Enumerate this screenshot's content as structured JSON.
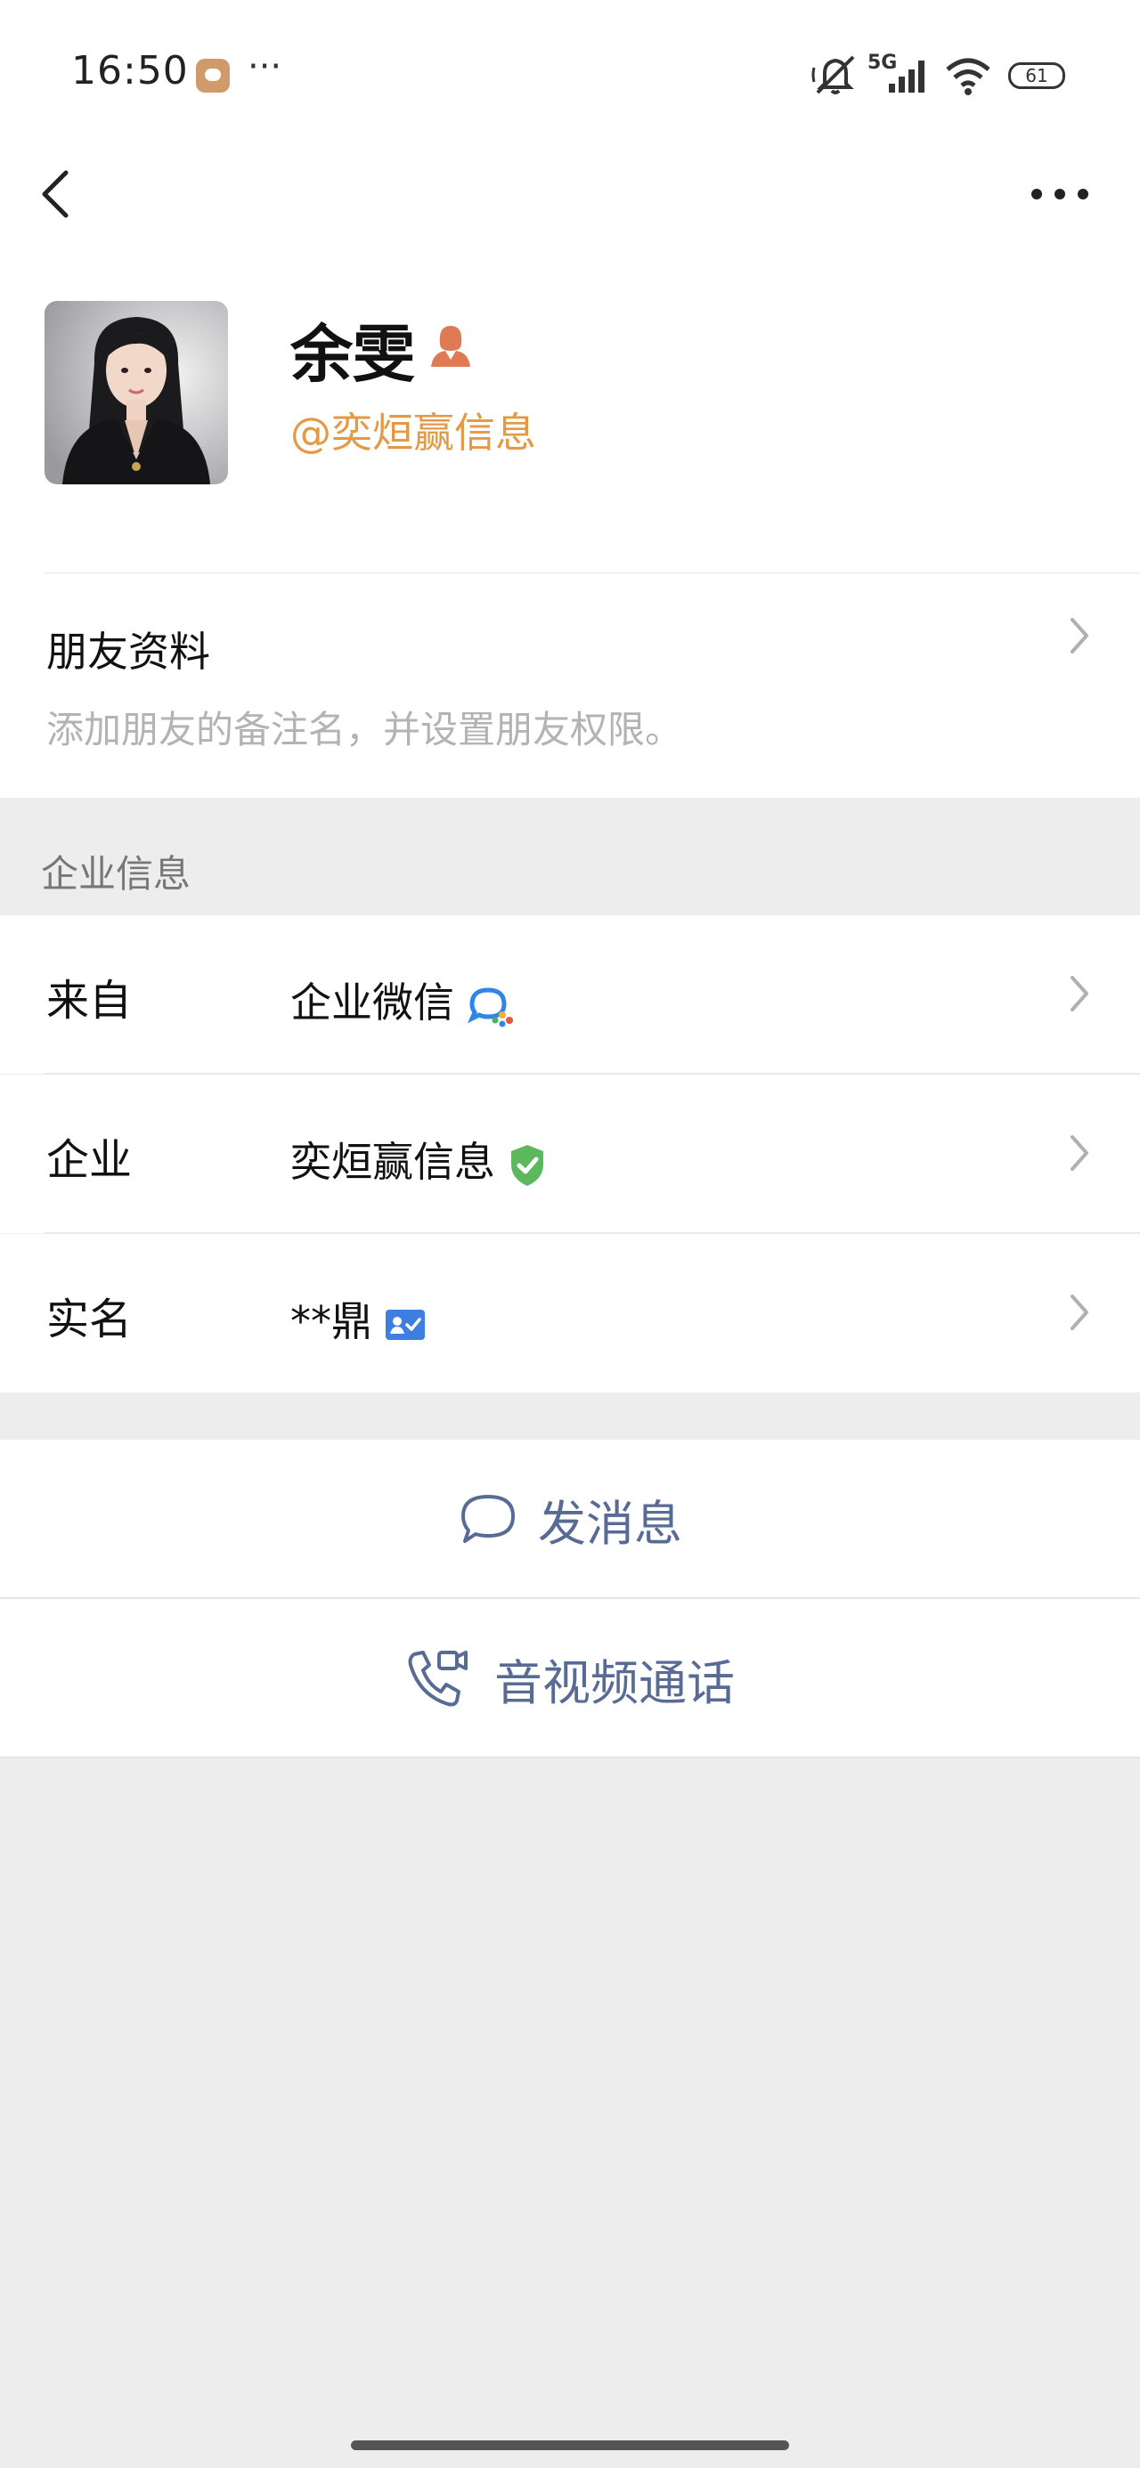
{
  "status_bar": {
    "time": "16:50",
    "more": "···",
    "network": "5G",
    "battery": "61"
  },
  "nav": {
    "back_icon": "chevron-left-icon",
    "more_icon": "more-dots-icon"
  },
  "profile": {
    "name": "余雯",
    "company_tag": "@奕烜赢信息",
    "name_badge_icon": "person-badge-icon"
  },
  "friend_info": {
    "title": "朋友资料",
    "subtitle": "添加朋友的备注名，并设置朋友权限。"
  },
  "enterprise_section": {
    "header": "企业信息",
    "rows": [
      {
        "label": "来自",
        "value": "企业微信",
        "icon": "wecom-icon"
      },
      {
        "label": "企业",
        "value": "奕烜赢信息",
        "icon": "verified-shield-icon"
      },
      {
        "label": "实名",
        "value": "**鼎",
        "icon": "id-card-icon"
      }
    ]
  },
  "actions": {
    "message": "发消息",
    "call": "音视频通话"
  },
  "colors": {
    "accent_link": "#576b95",
    "company_tag": "#e49a45",
    "verified": "#5cb85c",
    "id_card": "#3d7fe0",
    "page_bg": "#ededed"
  }
}
